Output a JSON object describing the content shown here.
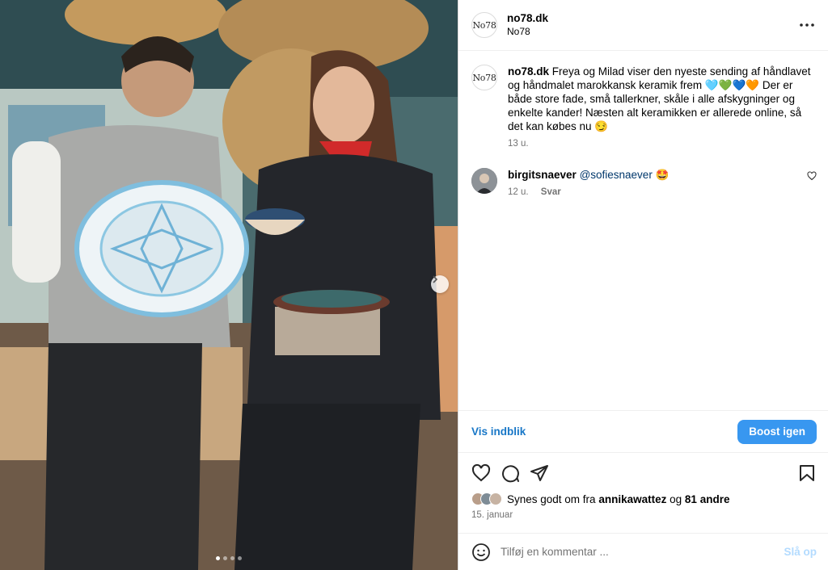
{
  "post": {
    "account": {
      "username": "no78.dk",
      "subtitle": "No78",
      "logo_text": "No78"
    },
    "caption": {
      "username": "no78.dk",
      "text": "Freya og Milad viser den nyeste sending af håndlavet og håndmalet marokkansk keramik frem 🩵💚💙🧡 Der er både store fade, små tallerkner, skåle i alle afskygninger og enkelte kander! Næsten alt keramikken er allerede online, så det kan købes nu 😏",
      "age": "13 u."
    },
    "comments": [
      {
        "username": "birgitsnaever",
        "mention": "@sofiesnaever",
        "emoji": "🤩",
        "age": "12 u.",
        "reply_label": "Svar"
      }
    ],
    "insights_label": "Vis indblik",
    "boost_label": "Boost igen",
    "likes": {
      "prefix": "Synes godt om fra",
      "user": "annikawattez",
      "joiner": "og",
      "others": "81 andre"
    },
    "date": "15. januar",
    "comment_input": {
      "placeholder": "Tilføj en kommentar ...",
      "post_label": "Slå op"
    }
  },
  "carousel": {
    "slide_count": 4,
    "active_index": 0
  },
  "colors": {
    "accent": "#3897f0",
    "link": "#1877c7",
    "muted": "#737373"
  },
  "icons": [
    "more-icon",
    "next-arrow-icon",
    "heart-icon",
    "comment-icon",
    "share-icon",
    "bookmark-icon",
    "emoji-icon",
    "heart-small-icon"
  ]
}
